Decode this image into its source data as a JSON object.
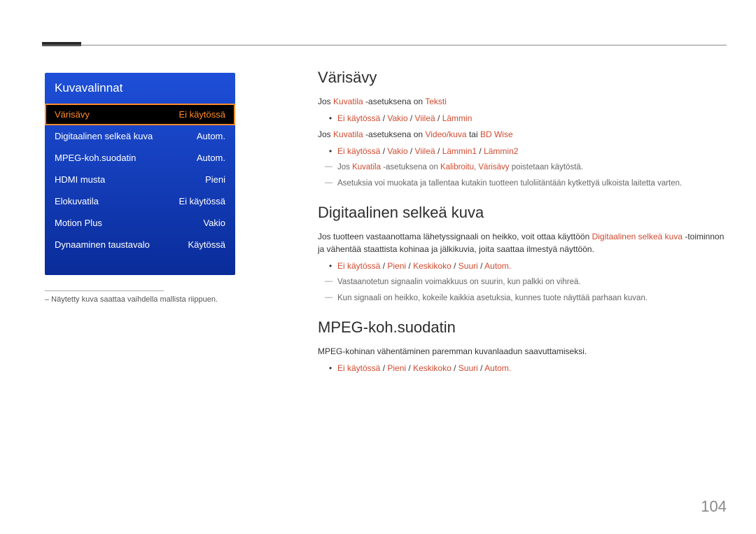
{
  "page_number": "104",
  "panel": {
    "title": "Kuvavalinnat",
    "rows": [
      {
        "label": "Värisävy",
        "value": "Ei käytössä",
        "selected": true
      },
      {
        "label": "Digitaalinen selkeä kuva",
        "value": "Autom."
      },
      {
        "label": "MPEG-koh.suodatin",
        "value": "Autom."
      },
      {
        "label": "HDMI musta",
        "value": "Pieni"
      },
      {
        "label": "Elokuvatila",
        "value": "Ei käytössä"
      },
      {
        "label": "Motion Plus",
        "value": "Vakio"
      },
      {
        "label": "Dynaaminen taustavalo",
        "value": "Käytössä"
      }
    ],
    "note": "– Näytetty kuva saattaa vaihdella mallista riippuen."
  },
  "sections": {
    "varisavy": {
      "heading": "Värisävy",
      "line1_pre": "Jos ",
      "line1_r1": "Kuvatila",
      "line1_mid": " -asetuksena on ",
      "line1_r2": "Teksti",
      "bullet1_a": "Ei käytössä",
      "bullet1_b": "Vakio",
      "bullet1_c": "Viileä",
      "bullet1_d": "Lämmin",
      "line2_pre": "Jos ",
      "line2_r1": "Kuvatila",
      "line2_mid": " -asetuksena on ",
      "line2_r2": "Video/kuva",
      "line2_mid2": " tai ",
      "line2_r3": "BD Wise",
      "bullet2_a": "Ei käytössä",
      "bullet2_b": "Vakio",
      "bullet2_c": "Viileä",
      "bullet2_d": "Lämmin1",
      "bullet2_e": "Lämmin2",
      "note1_pre": "Jos ",
      "note1_r1": "Kuvatila",
      "note1_mid": " -asetuksena on ",
      "note1_r2": "Kalibroitu",
      "note1_sep": ", ",
      "note1_r3": "Värisävy",
      "note1_post": " poistetaan käytöstä.",
      "note2": "Asetuksia voi muokata ja tallentaa kutakin tuotteen tuloliitäntään kytkettyä ulkoista laitetta varten."
    },
    "digi": {
      "heading": "Digitaalinen selkeä kuva",
      "para_pre": "Jos tuotteen vastaanottama lähetyssignaali on heikko, voit ottaa käyttöön ",
      "para_r1": "Digitaalinen selkeä kuva",
      "para_post": " -toiminnon ja vähentää staattista kohinaa ja jälkikuvia, joita saattaa ilmestyä näyttöön.",
      "bullet_a": "Ei käytössä",
      "bullet_b": "Pieni",
      "bullet_c": "Keskikoko",
      "bullet_d": "Suuri",
      "bullet_e": "Autom.",
      "note1": "Vastaanotetun signaalin voimakkuus on suurin, kun palkki on vihreä.",
      "note2": "Kun signaali on heikko, kokeile kaikkia asetuksia, kunnes tuote näyttää parhaan kuvan."
    },
    "mpeg": {
      "heading": "MPEG-koh.suodatin",
      "para": "MPEG-kohinan vähentäminen paremman kuvanlaadun saavuttamiseksi.",
      "bullet_a": "Ei käytössä",
      "bullet_b": "Pieni",
      "bullet_c": "Keskikoko",
      "bullet_d": "Suuri",
      "bullet_e": "Autom."
    }
  }
}
